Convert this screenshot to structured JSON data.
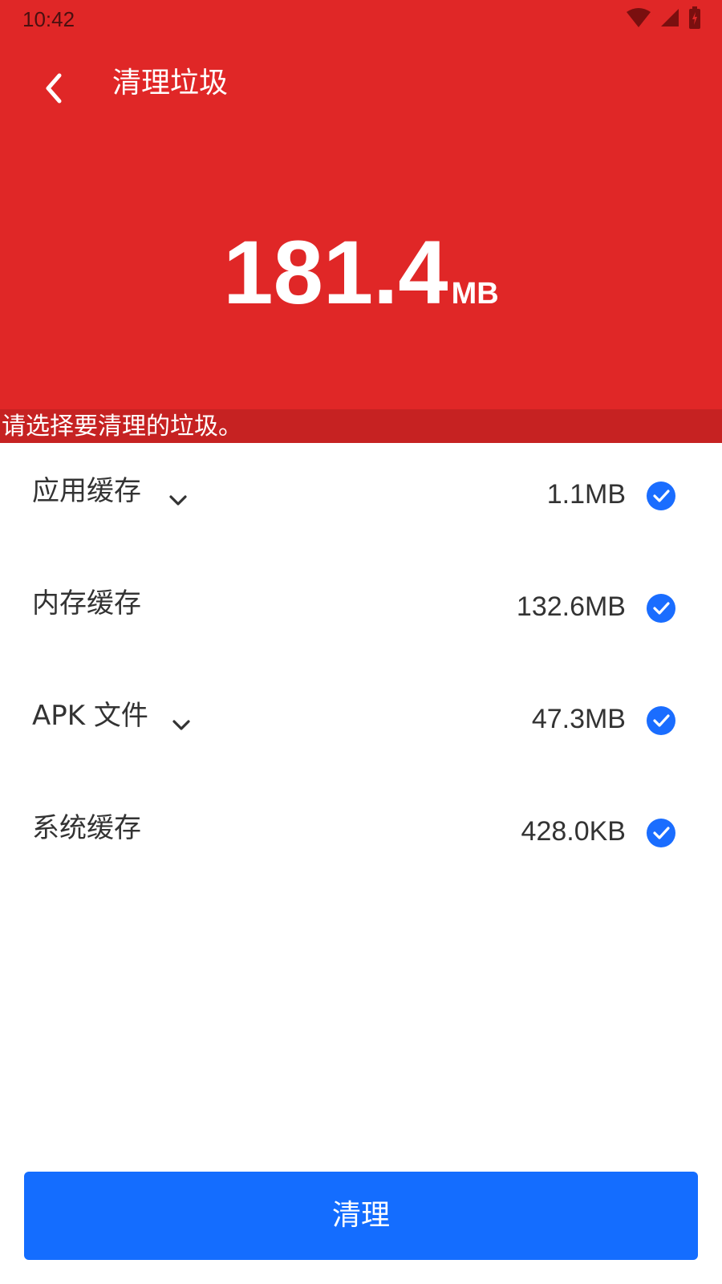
{
  "status_bar": {
    "time": "10:42",
    "icons": [
      "wifi-icon",
      "signal-icon",
      "battery-icon"
    ]
  },
  "header": {
    "title": "清理垃圾",
    "back_icon": "back-arrow-icon",
    "total_value": "181.4",
    "total_unit": "MB"
  },
  "hint": "请选择要清理的垃圾。",
  "items": [
    {
      "label": "应用缓存",
      "size": "1.1MB",
      "expandable": true,
      "checked": true
    },
    {
      "label": "内存缓存",
      "size": "132.6MB",
      "expandable": false,
      "checked": true
    },
    {
      "label": "APK 文件",
      "size": "47.3MB",
      "expandable": true,
      "checked": true
    },
    {
      "label": "系统缓存",
      "size": "428.0KB",
      "expandable": false,
      "checked": true
    }
  ],
  "button": {
    "label": "清理"
  },
  "colors": {
    "header_red": "#e02727",
    "hint_red": "#c62222",
    "accent_blue": "#146dff"
  }
}
